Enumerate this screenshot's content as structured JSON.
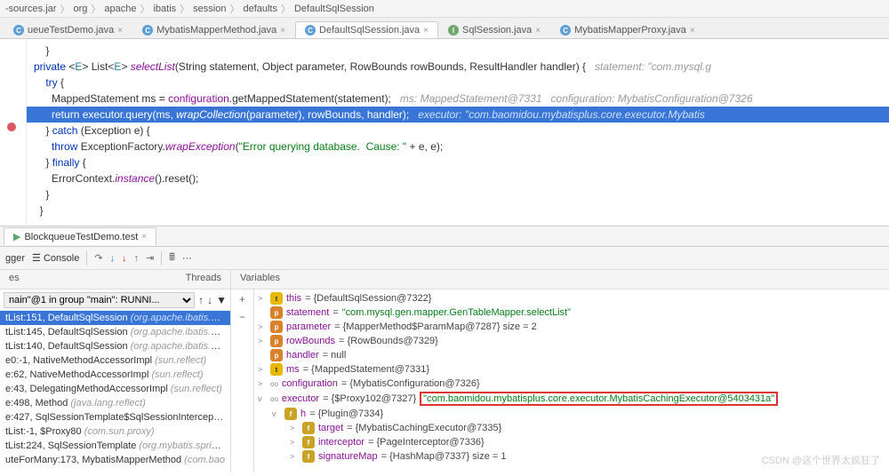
{
  "breadcrumb": [
    "-sources.jar",
    "org",
    "apache",
    "ibatis",
    "session",
    "defaults",
    "DefaultSqlSession"
  ],
  "editorTabs": [
    {
      "icon": "c",
      "label": "ueueTestDemo.java"
    },
    {
      "icon": "c",
      "label": "MybatisMapperMethod.java"
    },
    {
      "icon": "c",
      "label": "DefaultSqlSession.java",
      "active": true
    },
    {
      "icon": "i",
      "label": "SqlSession.java"
    },
    {
      "icon": "c",
      "label": "MybatisMapperProxy.java"
    }
  ],
  "code": {
    "l0": "    }",
    "l1": "",
    "l2_pre": "  private <E> List<E> ",
    "l2_m": "selectList",
    "l2_post": "(String statement, Object parameter, RowBounds rowBounds, ResultHandler handler) {",
    "l2_inline": "   statement: \"com.mysql.g",
    "l3": "    try {",
    "l4_a": "      MappedStatement ms = ",
    "l4_b": "configuration",
    "l4_c": ".getMappedStatement(statement);",
    "l4_inline": "   ms: MappedStatement@7331   configuration: MybatisConfiguration@7326",
    "l5_a": "      return ",
    "l5_b": "executor",
    "l5_c": ".query(ms, ",
    "l5_d": "wrapCollection",
    "l5_e": "(parameter), rowBounds, handler);",
    "l5_inline": "   executor: \"com.baomidou.mybatisplus.core.executor.Mybatis",
    "l6": "    } catch (Exception e) {",
    "l7_a": "      throw ExceptionFactory.",
    "l7_b": "wrapException",
    "l7_c": "(",
    "l7_str": "\"Error querying database.  Cause: \"",
    "l7_d": " + e, e);",
    "l8": "    } finally {",
    "l9_a": "      ErrorContext.",
    "l9_b": "instance",
    "l9_c": "().reset();",
    "l10": "    }",
    "l11": "  }"
  },
  "debugTab": "BlockqueueTestDemo.test",
  "toolbar": {
    "debugger": "gger",
    "console": "Console"
  },
  "panels": {
    "frames": "es",
    "threads": "Threads",
    "vars": "Variables"
  },
  "threadSelect": "nain\"@1 in group \"main\": RUNNI...",
  "frames": [
    {
      "label": "tList:151, DefaultSqlSession",
      "pkg": "(org.apache.ibatis.sessio",
      "sel": true
    },
    {
      "label": "tList:145, DefaultSqlSession",
      "pkg": "(org.apache.ibatis.session.d"
    },
    {
      "label": "tList:140, DefaultSqlSession",
      "pkg": "(org.apache.ibatis.session.d"
    },
    {
      "label": "e0:-1, NativeMethodAccessorImpl",
      "pkg": "(sun.reflect)"
    },
    {
      "label": "e:62, NativeMethodAccessorImpl",
      "pkg": "(sun.reflect)"
    },
    {
      "label": "e:43, DelegatingMethodAccessorImpl",
      "pkg": "(sun.reflect)"
    },
    {
      "label": "e:498, Method",
      "pkg": "(java.lang.reflect)"
    },
    {
      "label": "e:427, SqlSessionTemplate$SqlSessionInterceptor",
      "pkg": "(o"
    },
    {
      "label": "tList:-1, $Proxy80",
      "pkg": "(com.sun.proxy)"
    },
    {
      "label": "tList:224, SqlSessionTemplate",
      "pkg": "(org.mybatis.spring)"
    },
    {
      "label": "uteForMany:173, MybatisMapperMethod",
      "pkg": "(com.bao"
    }
  ],
  "vars": [
    {
      "arrow": ">",
      "badge": "t",
      "name": "this",
      "val": " = {DefaultSqlSession@7322}"
    },
    {
      "arrow": "",
      "badge": "p",
      "name": "statement",
      "val": " = ",
      "str": "\"com.mysql.gen.mapper.GenTableMapper.selectList\""
    },
    {
      "arrow": ">",
      "badge": "p",
      "name": "parameter",
      "val": " = {MapperMethod$ParamMap@7287}  size = 2"
    },
    {
      "arrow": ">",
      "badge": "p",
      "name": "rowBounds",
      "val": " = {RowBounds@7329}"
    },
    {
      "arrow": "",
      "badge": "p",
      "name": "handler",
      "val": " = null"
    },
    {
      "arrow": ">",
      "badge": "t",
      "name": "ms",
      "val": " = {MappedStatement@7331}"
    },
    {
      "arrow": ">",
      "badge": "oo",
      "name": "configuration",
      "val": " = {MybatisConfiguration@7326}"
    }
  ],
  "executor": {
    "arrow": "v",
    "badge": "oo",
    "name": "executor",
    "pre": " = {$Proxy102@7327} ",
    "boxed": "\"com.baomidou.mybatisplus.core.executor.MybatisCachingExecutor@5403431a\""
  },
  "executorChildren": [
    {
      "arrow": "v",
      "badge": "f",
      "name": "h",
      "val": " = {Plugin@7334}"
    },
    {
      "indent": 1,
      "arrow": ">",
      "badge": "f",
      "name": "target",
      "val": " = {MybatisCachingExecutor@7335}"
    },
    {
      "indent": 1,
      "arrow": ">",
      "badge": "f",
      "name": "interceptor",
      "val": " = {PageInterceptor@7336}"
    },
    {
      "indent": 1,
      "arrow": ">",
      "badge": "f",
      "name": "signatureMap",
      "val": " = {HashMap@7337}  size = 1"
    }
  ],
  "watermark": "CSDN @这个世界太疯狂了"
}
